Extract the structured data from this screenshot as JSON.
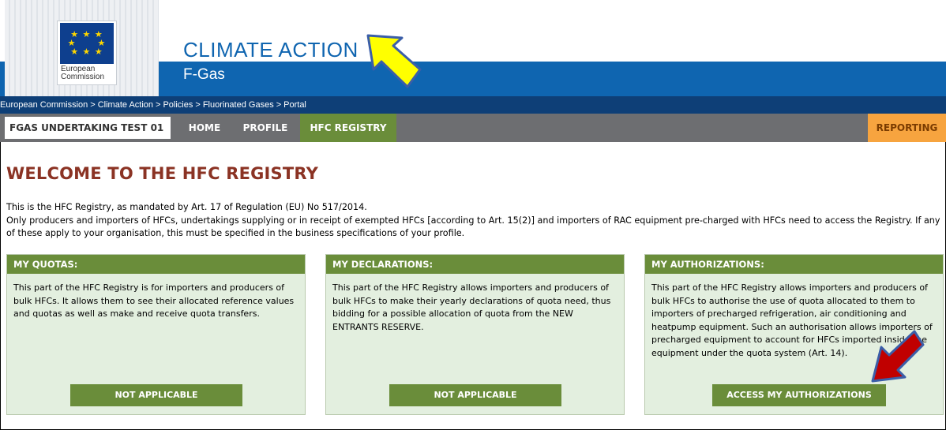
{
  "header": {
    "logo_line1": "European",
    "logo_line2": "Commission",
    "title": "CLIMATE ACTION",
    "subtitle": "F-Gas"
  },
  "breadcrumb": [
    "European Commission",
    "Climate Action",
    "Policies",
    "Fluorinated Gases",
    "Portal"
  ],
  "breadcrumb_sep": ">",
  "nav": {
    "organisation": "FGAS UNDERTAKING TEST 01",
    "tabs": {
      "home": "HOME",
      "profile": "PROFILE",
      "hfc_registry": "HFC REGISTRY",
      "reporting": "REPORTING"
    },
    "active_color": "#6a8d3a",
    "reporting_color": "#f7a43f"
  },
  "main": {
    "heading": "WELCOME TO THE HFC REGISTRY",
    "intro_line1": "This is the HFC Registry, as mandated by Art. 17 of Regulation (EU) No 517/2014.",
    "intro_line2": "Only producers and importers of HFCs, undertakings supplying or in receipt of exempted HFCs [according to Art. 15(2)] and importers of RAC equipment pre-charged with HFCs need to access the Registry. If any of these apply to your organisation, this must be specified in the business specifications of your profile."
  },
  "panels": [
    {
      "title": "MY QUOTAS:",
      "text": "This part of the HFC Registry is for importers and producers of bulk HFCs. It allows them to see their allocated reference values and quotas as well as make and receive quota transfers.",
      "button": "NOT APPLICABLE"
    },
    {
      "title": "MY DECLARATIONS:",
      "text": "This part of the HFC Registry allows importers and producers of bulk HFCs to make their yearly declarations of quota need, thus bidding for a possible allocation of quota from the NEW ENTRANTS RESERVE.",
      "button": "NOT APPLICABLE"
    },
    {
      "title": "MY AUTHORIZATIONS:",
      "text": "This part of the HFC Registry allows importers and producers of bulk HFCs to authorise the use of quota allocated to them to importers of precharged refrigeration, air conditioning and heatpump equipment. Such an authorisation allows importers of precharged equipment to account for HFCs imported inside the equipment under the quota system (Art. 14).",
      "button": "ACCESS MY AUTHORIZATIONS"
    }
  ],
  "annotations": {
    "arrow_tab_color": "#ffff00",
    "arrow_button_color": "#c00000",
    "arrow_outline": "#3b5ea8"
  }
}
